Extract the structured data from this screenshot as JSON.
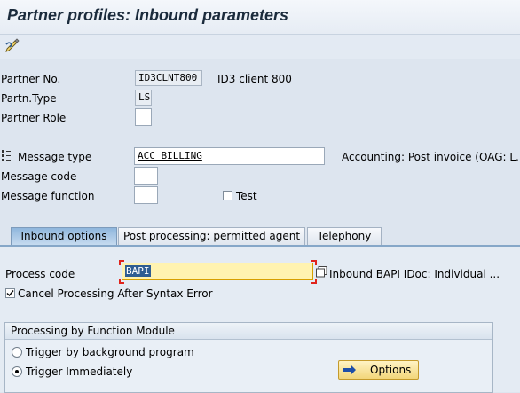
{
  "window": {
    "title": "Partner profiles: Inbound parameters"
  },
  "toolbar": {
    "icons": [
      "display-change-icon"
    ]
  },
  "partner": {
    "no_label": "Partner No.",
    "no_value": "ID3CLNT800",
    "no_desc": "ID3 client 800",
    "type_label": "Partn.Type",
    "type_value": "LS",
    "role_label": "Partner Role",
    "role_value": ""
  },
  "message": {
    "type_label": "Message type",
    "type_value": "ACC_BILLING",
    "type_desc": "Accounting: Post invoice (OAG: L...",
    "code_label": "Message code",
    "code_value": "",
    "function_label": "Message function",
    "function_value": "",
    "test_label": "Test",
    "test_checked": false
  },
  "tabs": [
    {
      "label": "Inbound options",
      "active": true
    },
    {
      "label": "Post processing: permitted agent",
      "active": false
    },
    {
      "label": "Telephony",
      "active": false
    }
  ],
  "inbound": {
    "process_code_label": "Process code",
    "process_code_value": "BAPI",
    "process_code_desc": "Inbound BAPI IDoc: Individual ...",
    "cancel_label": "Cancel Processing After Syntax Error",
    "cancel_checked": true
  },
  "processing": {
    "group_title": "Processing by Function Module",
    "radio_background": "Trigger by background program",
    "radio_immediately": "Trigger Immediately",
    "selected": "immediately",
    "options_label": "Options"
  },
  "colors": {
    "accent": "#2e5d92",
    "required_marker": "#e0241b",
    "field_highlight": "#fff3b0"
  }
}
